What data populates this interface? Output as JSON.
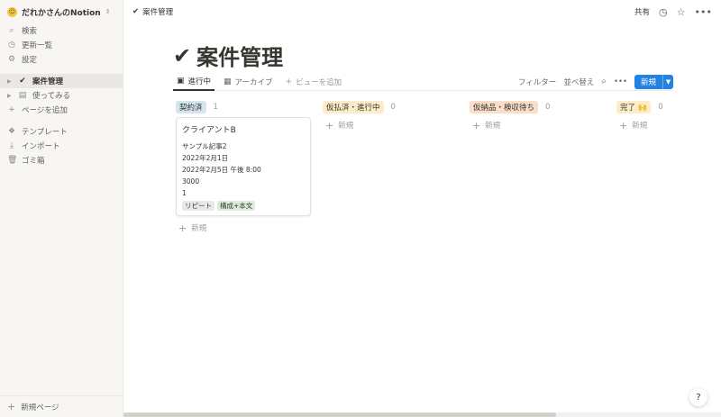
{
  "sidebar": {
    "workspace": "だれかさんのNotion",
    "top_items": [
      {
        "icon": "search-icon",
        "label": "検索"
      },
      {
        "icon": "clock-icon",
        "label": "更新一覧"
      },
      {
        "icon": "gear-icon",
        "label": "設定"
      }
    ],
    "pages": [
      {
        "icon": "check-icon",
        "label": "案件管理"
      },
      {
        "icon": "page-icon",
        "label": "使ってみる"
      }
    ],
    "add_page": "ページを追加",
    "bottom_items": [
      {
        "icon": "template-icon",
        "label": "テンプレート"
      },
      {
        "icon": "import-icon",
        "label": "インポート"
      },
      {
        "icon": "trash-icon",
        "label": "ゴミ箱"
      }
    ],
    "new_page": "新規ページ"
  },
  "topbar": {
    "breadcrumb": "案件管理",
    "share": "共有"
  },
  "page": {
    "title": "案件管理",
    "tabs": [
      {
        "label": "進行中"
      },
      {
        "label": "アーカイブ"
      },
      {
        "label": "ビューを追加"
      }
    ],
    "filter": "フィルター",
    "sort": "並べ替え",
    "new_button": "新規"
  },
  "board": {
    "add_label": "新規",
    "columns": [
      {
        "label": "契約済",
        "count": "1",
        "color": "#d3e5ef"
      },
      {
        "label": "仮払済・進行中",
        "count": "0",
        "color": "#fdecc8"
      },
      {
        "label": "仮納品・検収待ち",
        "count": "0",
        "color": "#fadec9"
      },
      {
        "label": "完了 🙌",
        "count": "0",
        "color": "#fdecc8"
      }
    ],
    "card": {
      "title": "クライアントB",
      "lines": [
        "サンプル記事2",
        "2022年2月1日",
        "2022年2月5日 午後 8:00",
        "3000",
        "1"
      ],
      "tags": [
        {
          "label": "リピート",
          "color": "#e9e9e7"
        },
        {
          "label": "構成+本文",
          "color": "#dbeddb"
        }
      ]
    }
  },
  "help": "?"
}
